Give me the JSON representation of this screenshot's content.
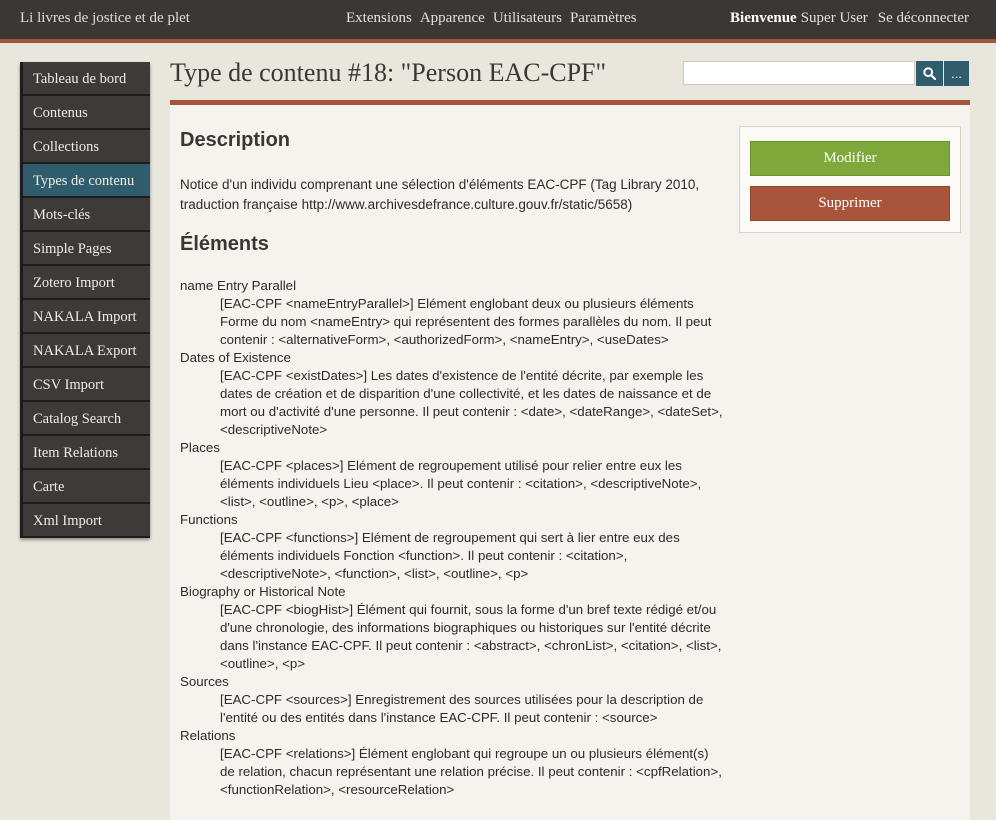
{
  "topbar": {
    "site_title": "Li livres de jostice et de plet",
    "nav": [
      "Extensions",
      "Apparence",
      "Utilisateurs",
      "Paramètres"
    ],
    "welcome": "Bienvenue",
    "username": "Super User",
    "logout": "Se déconnecter"
  },
  "sidebar": {
    "items": [
      {
        "label": "Tableau de bord"
      },
      {
        "label": "Contenus"
      },
      {
        "label": "Collections"
      },
      {
        "label": "Types de contenu"
      },
      {
        "label": "Mots-clés"
      },
      {
        "label": "Simple Pages"
      },
      {
        "label": "Zotero Import"
      },
      {
        "label": "NAKALA Import"
      },
      {
        "label": "NAKALA Export"
      },
      {
        "label": "CSV Import"
      },
      {
        "label": "Catalog Search"
      },
      {
        "label": "Item Relations"
      },
      {
        "label": "Carte"
      },
      {
        "label": "Xml Import"
      }
    ],
    "active_index": 3
  },
  "page": {
    "title": "Type de contenu #18: \"Person EAC-CPF\"",
    "search_icon": "search-icon",
    "advanced_label": "..."
  },
  "actions": {
    "edit_label": "Modifier",
    "delete_label": "Supprimer",
    "edit_color": "#7ea93a",
    "delete_color": "#a9553b"
  },
  "description": {
    "heading": "Description",
    "text": "Notice d'un individu comprenant une sélection d'éléments EAC-CPF (Tag Library 2010, traduction française http://www.archivesdefrance.culture.gouv.fr/static/5658)"
  },
  "elements": {
    "heading": "Éléments",
    "items": [
      {
        "name": "name Entry Parallel",
        "desc": "[EAC-CPF <nameEntryParallel>] Elément englobant deux ou plusieurs éléments Forme du nom <nameEntry> qui représentent des formes parallèles du nom. Il peut contenir : <alternativeForm>, <authorizedForm>, <nameEntry>, <useDates>"
      },
      {
        "name": "Dates of Existence",
        "desc": "[EAC-CPF <existDates>] Les dates d'existence de l'entité décrite, par exemple les dates de création et de disparition d'une collectivité, et les dates de naissance et de mort ou d'activité d'une personne. Il peut contenir : <date>, <dateRange>, <dateSet>, <descriptiveNote>"
      },
      {
        "name": "Places",
        "desc": "[EAC-CPF <places>] Elément de regroupement utilisé pour relier entre eux les éléments individuels Lieu <place>. Il peut contenir : <citation>, <descriptiveNote>, <list>, <outline>, <p>, <place>"
      },
      {
        "name": "Functions",
        "desc": "[EAC-CPF <functions>] Elément de regroupement qui sert à lier entre eux des éléments individuels Fonction <function>. Il peut contenir : <citation>, <descriptiveNote>, <function>, <list>, <outline>, <p>"
      },
      {
        "name": "Biography or Historical Note",
        "desc": "[EAC-CPF <biogHist>] Élément qui fournit, sous la forme d'un bref texte rédigé et/ou d'une chronologie, des informations biographiques ou historiques sur l'entité décrite dans l'instance EAC-CPF. Il peut contenir : <abstract>, <chronList>, <citation>, <list>, <outline>, <p>"
      },
      {
        "name": "Sources",
        "desc": "[EAC-CPF <sources>] Enregistrement des sources utilisées pour la description de l'entité ou des entités dans l'instance EAC-CPF. Il peut contenir : <source>"
      },
      {
        "name": "Relations",
        "desc": "[EAC-CPF <relations>] Élément englobant qui regroupe un ou plusieurs élément(s) de relation, chacun représentant une relation précise. Il peut contenir : <cpfRelation>, <functionRelation>, <resourceRelation>"
      }
    ]
  }
}
